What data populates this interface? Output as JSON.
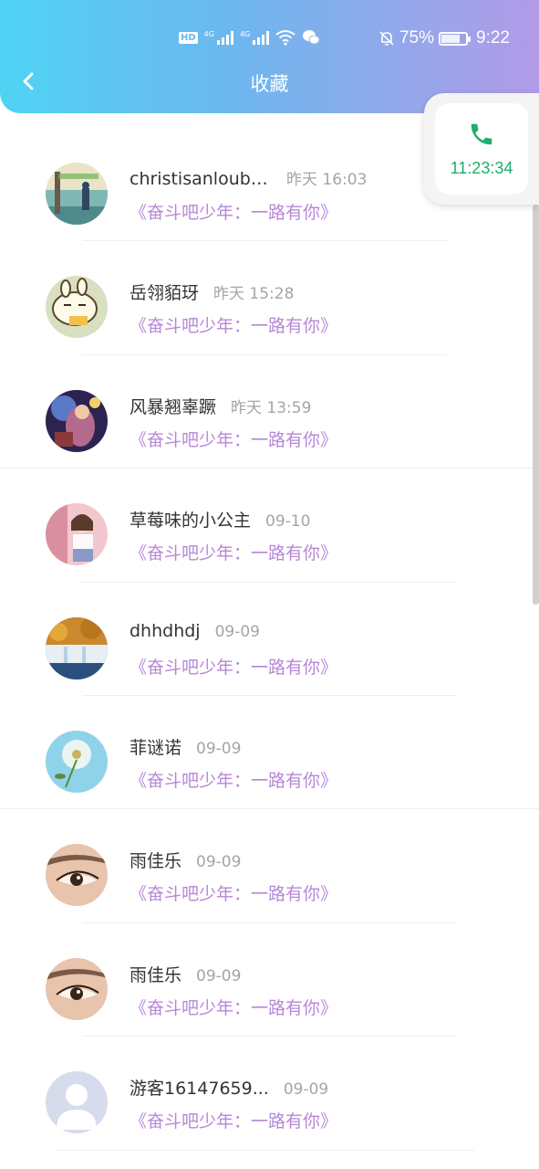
{
  "status_bar": {
    "hd_label": "HD",
    "network1": "4G",
    "network2": "4G",
    "battery_percent": "75%",
    "time": "9:22"
  },
  "header": {
    "title": "收藏"
  },
  "call_widget": {
    "duration": "11:23:34",
    "icon": "phone-icon",
    "color": "#1fae6b"
  },
  "colors": {
    "subtitle": "#b787d6",
    "header_gradient": [
      "#4fd3f5",
      "#6fb6ee",
      "#b29be8"
    ]
  },
  "favorites": [
    {
      "name": "christisanloubc...",
      "time": "昨天 16:03",
      "subtitle": "《奋斗吧少年：一路有你》",
      "avatar": "avatar-landscape"
    },
    {
      "name": "岳翎貊玡",
      "time": "昨天 15:28",
      "subtitle": "《奋斗吧少年：一路有你》",
      "avatar": "avatar-cartoon"
    },
    {
      "name": "风暴翘辜蹶",
      "time": "昨天 13:59",
      "subtitle": "《奋斗吧少年：一路有你》",
      "avatar": "avatar-game"
    },
    {
      "name": "草莓味的小公主",
      "time": "09-10",
      "subtitle": "《奋斗吧少年：一路有你》",
      "avatar": "avatar-girl"
    },
    {
      "name": "dhhdhdj",
      "time": "09-09",
      "subtitle": "《奋斗吧少年：一路有你》",
      "avatar": "avatar-waterfall"
    },
    {
      "name": "菲谜诺",
      "time": "09-09",
      "subtitle": "《奋斗吧少年：一路有你》",
      "avatar": "avatar-dandelion"
    },
    {
      "name": "雨佳乐",
      "time": "09-09",
      "subtitle": "《奋斗吧少年：一路有你》",
      "avatar": "avatar-eye"
    },
    {
      "name": "雨佳乐",
      "time": "09-09",
      "subtitle": "《奋斗吧少年：一路有你》",
      "avatar": "avatar-eye"
    },
    {
      "name": "游客16147659...",
      "time": "09-09",
      "subtitle": "《奋斗吧少年：一路有你》",
      "avatar": "avatar-default"
    }
  ]
}
